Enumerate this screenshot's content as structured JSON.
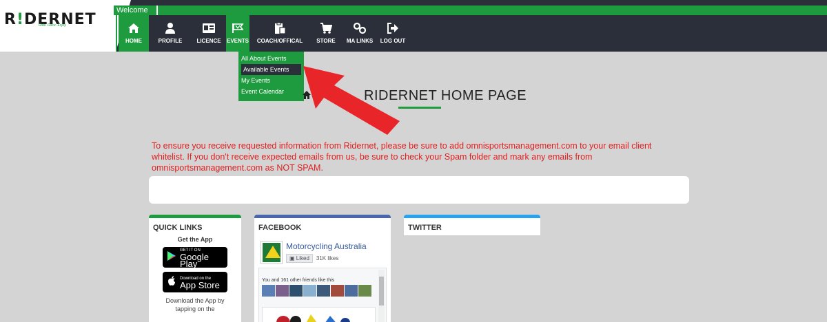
{
  "header": {
    "logo_text_1": "R",
    "logo_text_2": "!",
    "logo_text_3": "DERNET",
    "tagline": "Ride. Race. Enjoy",
    "welcome": "Welcome"
  },
  "nav": {
    "items": [
      {
        "label": "HOME",
        "icon": "home-icon"
      },
      {
        "label": "PROFILE",
        "icon": "user-icon"
      },
      {
        "label": "LICENCE",
        "icon": "id-card-icon"
      },
      {
        "label": "EVENTS",
        "icon": "flag-icon"
      },
      {
        "label": "COACH/OFFICAL",
        "icon": "clipboard-icon"
      },
      {
        "label": "STORE",
        "icon": "cart-icon"
      },
      {
        "label": "MA LINKS",
        "icon": "link-icon"
      },
      {
        "label": "LOG OUT",
        "icon": "logout-icon"
      }
    ]
  },
  "dropdown": {
    "items": [
      "All About Events",
      "Available Events",
      "My Events",
      "Event Calendar"
    ]
  },
  "page": {
    "title": "RIDERNET HOME PAGE",
    "notice": "To ensure you receive requested information from Ridernet, please be sure to add omnisportsmanagement.com to your email client whitelist. If you don't receive expected emails from us, be sure to check your Spam folder and mark any emails from omnisportsmanagement.com as NOT SPAM."
  },
  "quick_links": {
    "heading": "QUICK LINKS",
    "get_app": "Get the App",
    "google_small": "GET IT ON",
    "google_big": "Google Play",
    "apple_small": "Download on the",
    "apple_big": "App Store",
    "download_text": "Download the App by tapping on the"
  },
  "facebook": {
    "heading": "FACEBOOK",
    "page_name": "Motorcycling Australia",
    "liked": "Liked",
    "likes": "31K likes",
    "friends": "You and 161 other friends like this"
  },
  "twitter": {
    "heading": "TWITTER"
  },
  "colors": {
    "brand_green": "#1e9a3f",
    "nav_dark": "#2b2f3a",
    "notice_red": "#e0201f",
    "facebook_blue": "#4a67ad",
    "twitter_blue": "#2aa3ef",
    "arrow_red": "#e8262a"
  }
}
